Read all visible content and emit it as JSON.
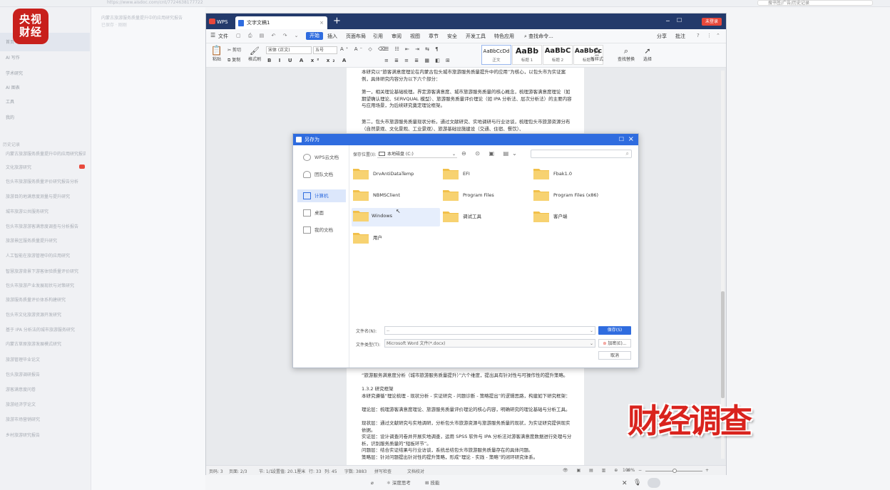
{
  "browser": {
    "url": "https://www.aisdoc.com/cnt/7724638177722",
    "search_placeholder": "搜书签/广告/历史记录"
  },
  "logo": {
    "line1": "央视",
    "line2": "财经"
  },
  "sidebar": {
    "nav_items": [
      "首页",
      "AI 写作",
      "学术研究",
      "AI 图表",
      "工具",
      "我的"
    ],
    "section_label": "历史记录",
    "recent": [
      "内蒙古旅游服务质量提升中的应用研究报告",
      "文化旅游研究",
      "包头市旅游服务质量评价研究报告分析",
      "旅游目的地满意度测量与提升研究",
      "城市旅游公共服务研究",
      "包头市旅游游客满意度调查与分析报告",
      "旅游景区服务质量提升研究",
      "人工智能在旅游管理中的应用研究",
      "智慧旅游背景下游客体验质量评价研究",
      "包头市旅游产业发展现状与对策研究",
      "旅游服务质量评价体系构建研究",
      "包头市文化旅游资源开发研究",
      "基于 IPA 分析法的城市旅游服务研究",
      "内蒙古草原旅游发展模式研究",
      "旅游管理毕业论文",
      "包头旅游调研报告",
      "游客满意度问卷",
      "旅游经济学论文",
      "旅游市场营销研究",
      "乡村旅游研究报告"
    ]
  },
  "midpanel": {
    "title": "内蒙古旅游服务质量提升中的应用研究报告",
    "subtitle": "已保存 · 刚刚"
  },
  "wps": {
    "app_tab": "WPS",
    "doc_tab": "文字文稿1",
    "login_button": "未登录",
    "menu": [
      "文件",
      "开始",
      "插入",
      "页面布局",
      "引用",
      "审阅",
      "视图",
      "章节",
      "安全",
      "开发工具",
      "特色应用",
      "查找命令..."
    ],
    "active_menu": "开始",
    "right_menu": [
      "分享",
      "批注"
    ],
    "ribbon": {
      "paste": "粘贴",
      "cut": "剪切",
      "copy": "复制",
      "format_painter": "格式刷",
      "font_name": "宋体 (正文)",
      "font_size": "五号",
      "styles": [
        {
          "sample": "AaBbCcDd",
          "name": "正文"
        },
        {
          "sample": "AaBb",
          "name": "标题 1"
        },
        {
          "sample": "AaBbC",
          "name": "标题 2"
        },
        {
          "sample": "AaBbCc",
          "name": "标题 3"
        }
      ],
      "new_style": "新样式",
      "find_replace": "查找替换",
      "select": "选择"
    },
    "doc_top_paragraphs": [
      "本研究以“旅客满意度理论在内蒙古包头城市旅游服务质量提升中的应用”为核心，以包头市为实证案例，具体研究内容分为以下六个部分：",
      "第一，相关理论基础梳理。界定游客满意度、城市旅游服务质量的核心概念，梳理游客满意度理论（如期望确认理论、SERVQUAL 模型）、旅游服务质量评价理论（如 IPA 分析法、层次分析法）的主要内容与应用场景，为后续研究奠定理论框架。",
      "第二，包头市旅游服务质量现状分析。通过文献研究、实地调研与行业访谈，梳理包头市旅游资源分布（自然景观、文化景观、工业景观）、旅游基础设施建设（交通、住宿、餐饮）、"
    ],
    "doc_bottom_paragraphs": [
      "“旅游服务满意度分析（城市旅游服务质量提升）”六个维度，提出具有针对性与可操作性的提升策略。",
      "1.3.2 研究框架",
      "本研究遵循“理论梳理 - 现状分析 - 实证研究 - 问题诊断 - 策略提出”的逻辑思路，构建如下研究框架：",
      "理论层：梳理游客满意度理论、旅游服务质量评价理论的核心内容，明确研究的理论基础与分析工具。",
      "现状层：通过文献研究与实地调研，分析包头市旅游资源与旅游服务质量的现状，为实证研究提供现实依据。",
      "实证层：设计调查问卷并开展实地调查，运用 SPSS 软件与 IPA 分析法对游客满意度数据进行处理与分析，识别服务质量的“短板环节”。",
      "问题层：结合实证结果与行业访谈，系统总结包头市旅游服务质量存在的具体问题。",
      "策略层：针对问题提出针对性的提升策略，形成“理论 - 实践 - 策略”的闭环研究体系。"
    ],
    "status": {
      "page": "页码: 3",
      "pages": "页面: 2/3",
      "section": "节: 1/1",
      "settings": "设置值: 20.1厘米",
      "row": "行: 33",
      "col": "列: 45",
      "words": "字数: 3883",
      "spell": "拼写检查",
      "doc_check": "文档校对",
      "zoom": "100%"
    }
  },
  "dialog": {
    "title": "另存为",
    "sidebar": [
      "WPS云文档",
      "团队文档",
      "计算机",
      "桌面",
      "我的文档"
    ],
    "active_side": "计算机",
    "location_label": "保存位置(I):",
    "location_value": "本地磁盘 (C:)",
    "folders": [
      "DrvAntiDataTemp",
      "EFI",
      "Fbak1.0",
      "NBMSClient",
      "Program Files",
      "Program Files (x86)",
      "Windows",
      "调试工具",
      "客户端",
      "用户"
    ],
    "hover_folder": "Windows",
    "filename_label": "文件名(N):",
    "filename_value": "--",
    "filetype_label": "文件类型(T):",
    "filetype_value": "Microsoft Word 文件(*.docx)",
    "save_button": "保存(S)",
    "encrypt_button": "加密(E)...",
    "cancel_button": "取消"
  },
  "overlay": {
    "watermark": "财经调查"
  },
  "bottom_toolbar": {
    "deep_think": "深度思考",
    "skills": "技能"
  }
}
